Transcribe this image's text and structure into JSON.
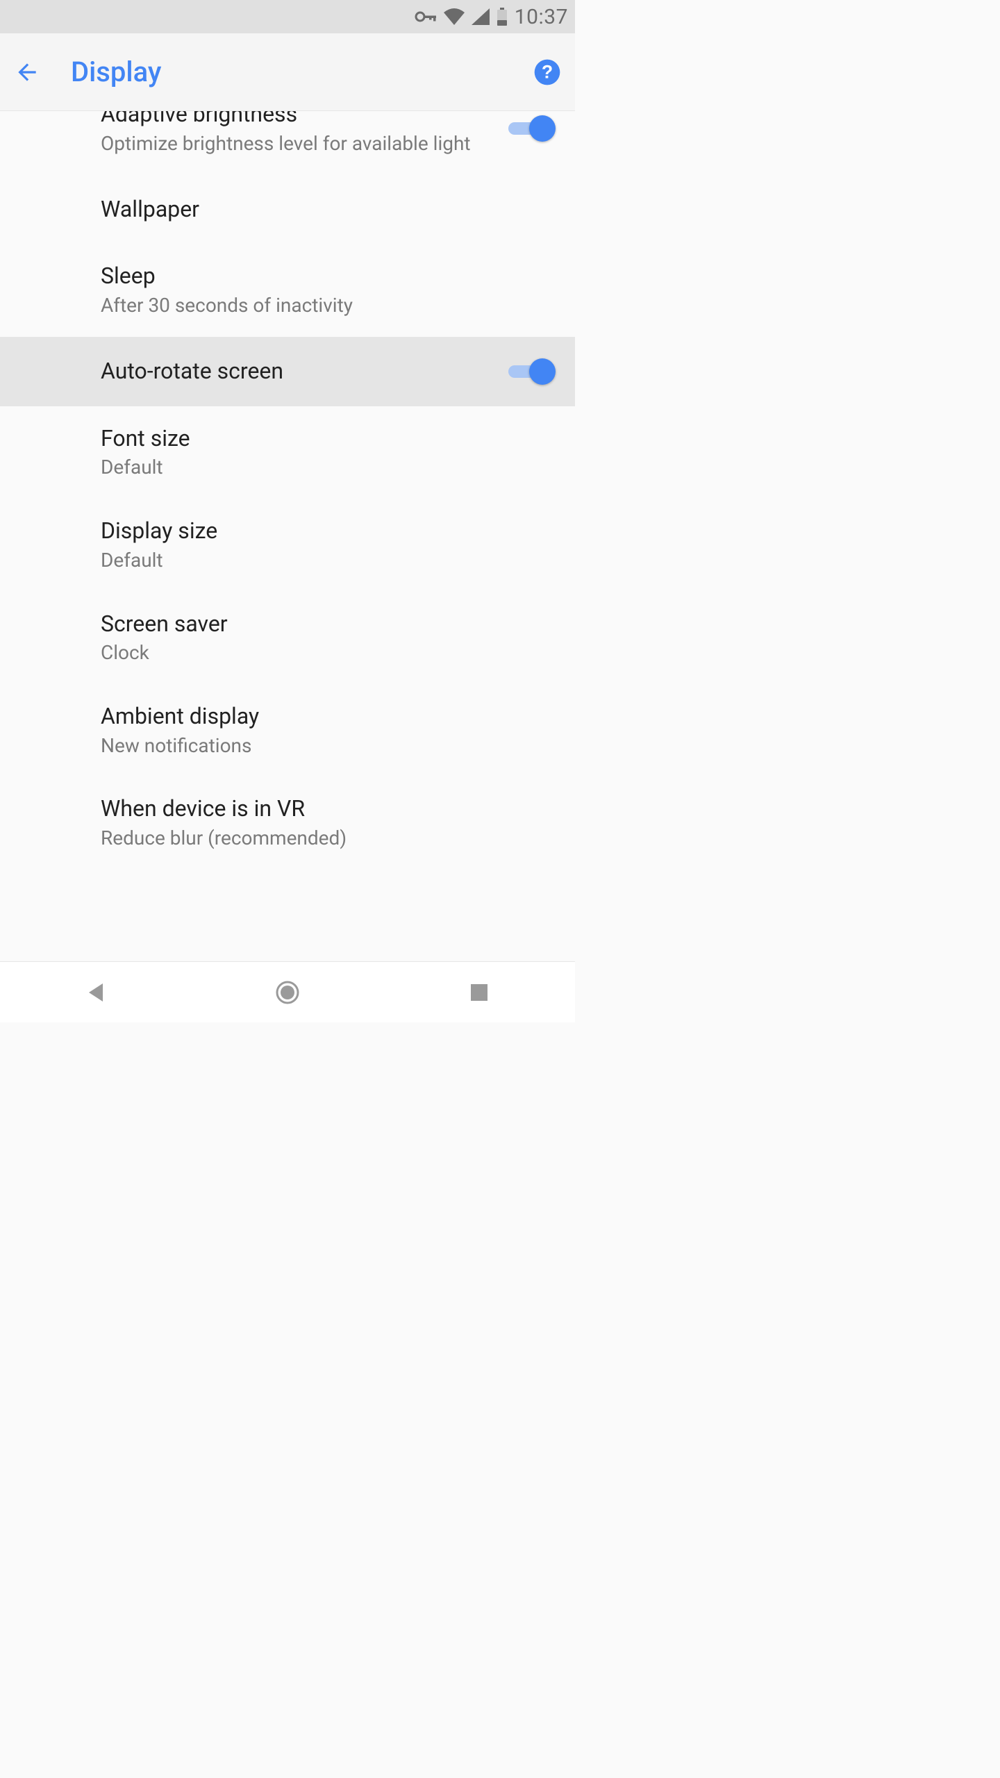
{
  "status_bar": {
    "time": "10:37"
  },
  "app_bar": {
    "title": "Display"
  },
  "settings": [
    {
      "title": "Adaptive brightness",
      "sub": "Optimize brightness level for available light",
      "toggle": true
    },
    {
      "title": "Wallpaper",
      "sub": ""
    },
    {
      "title": "Sleep",
      "sub": "After 30 seconds of inactivity"
    },
    {
      "title": "Auto-rotate screen",
      "sub": "",
      "toggle": true,
      "highlight": true
    },
    {
      "title": "Font size",
      "sub": "Default"
    },
    {
      "title": "Display size",
      "sub": "Default"
    },
    {
      "title": "Screen saver",
      "sub": "Clock"
    },
    {
      "title": "Ambient display",
      "sub": "New notifications"
    },
    {
      "title": "When device is in VR",
      "sub": "Reduce blur (recommended)"
    }
  ]
}
